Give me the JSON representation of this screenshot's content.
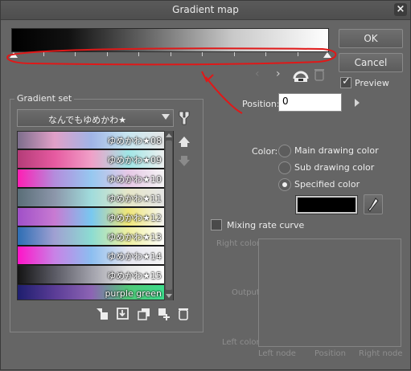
{
  "window": {
    "title": "Gradient map",
    "close_icon": "close-icon"
  },
  "buttons": {
    "ok": "OK",
    "cancel": "Cancel"
  },
  "preview": {
    "label": "Preview",
    "checked": true
  },
  "position": {
    "label": "Position:",
    "value": "0"
  },
  "color": {
    "label": "Color:",
    "options": [
      "Main drawing color",
      "Sub drawing color",
      "Specified color"
    ],
    "selected": "Specified color",
    "specified_color": "#000000"
  },
  "mixing": {
    "label": "Mixing rate curve",
    "checked": false
  },
  "curve": {
    "right_color": "Right color",
    "output": "Output",
    "left_color": "Left color",
    "left_node": "Left node",
    "position": "Position",
    "right_node": "Right node"
  },
  "gradient_set": {
    "title": "Gradient set",
    "selected": "なんでもゆめかわ★",
    "items": [
      {
        "label": "ゆめかわ★08",
        "colors": [
          "#7d6e8c",
          "#e1a0c8",
          "#a0b4e6",
          "#c8e6f0",
          "#e6e6e6"
        ]
      },
      {
        "label": "ゆめかわ★09",
        "colors": [
          "#b43c78",
          "#e65aa0",
          "#f0a0c8",
          "#a0e6e6",
          "#f0f0f0"
        ]
      },
      {
        "label": "ゆめかわ★10",
        "colors": [
          "#ff1eb4",
          "#b48cdc",
          "#96c8f0",
          "#e6c8e6",
          "#f5f5f5"
        ]
      },
      {
        "label": "ゆめかわ★11",
        "colors": [
          "#5a6e78",
          "#8c96aa",
          "#a0dcdc",
          "#e6e6c8",
          "#e6e6e6"
        ]
      },
      {
        "label": "ゆめかわ★12",
        "colors": [
          "#a050c8",
          "#c87ad2",
          "#78c8f0",
          "#f0e678",
          "#f5f5f5"
        ]
      },
      {
        "label": "ゆめかわ★13",
        "colors": [
          "#2d6eb4",
          "#a0a0d2",
          "#8cdcd2",
          "#f0f0a0",
          "#ffffff"
        ]
      },
      {
        "label": "ゆめかわ★14",
        "colors": [
          "#ff14c8",
          "#c882e6",
          "#8cbef0",
          "#e6e6f0",
          "#f5f5f5"
        ]
      },
      {
        "label": "ゆめかわ★15",
        "colors": [
          "#141414",
          "#5a5a64",
          "#a0a0aa",
          "#e6e6e6",
          "#ffffff"
        ]
      },
      {
        "label": "purple green",
        "colors": [
          "#1e1e6e",
          "#5a3c96",
          "#8c64b4",
          "#50c878",
          "#3cdc8c"
        ]
      }
    ]
  }
}
